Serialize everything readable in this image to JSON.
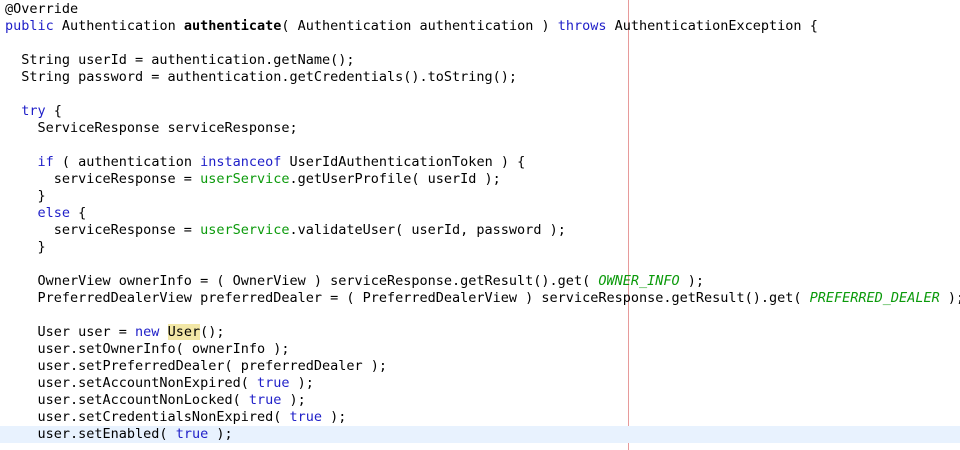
{
  "editor": {
    "lines": [
      [
        {
          "t": "@Override",
          "c": ""
        }
      ],
      [
        {
          "t": "public",
          "c": "kw2"
        },
        {
          "t": " Authentication ",
          "c": ""
        },
        {
          "t": "authenticate",
          "c": "bold"
        },
        {
          "t": "( Authentication authentication ) ",
          "c": ""
        },
        {
          "t": "throws",
          "c": "kw2"
        },
        {
          "t": " AuthenticationException {",
          "c": ""
        }
      ],
      [],
      [
        {
          "t": "  String userId = authentication.getName();",
          "c": ""
        }
      ],
      [
        {
          "t": "  String password = authentication.getCredentials().toString();",
          "c": ""
        }
      ],
      [],
      [
        {
          "t": "  ",
          "c": ""
        },
        {
          "t": "try",
          "c": "kw2"
        },
        {
          "t": " {",
          "c": ""
        }
      ],
      [
        {
          "t": "    ServiceResponse serviceResponse;",
          "c": ""
        }
      ],
      [],
      [
        {
          "t": "    ",
          "c": ""
        },
        {
          "t": "if",
          "c": "kw2"
        },
        {
          "t": " ( authentication ",
          "c": ""
        },
        {
          "t": "instanceof",
          "c": "kw2"
        },
        {
          "t": " UserIdAuthenticationToken ) {",
          "c": ""
        }
      ],
      [
        {
          "t": "      serviceResponse = ",
          "c": ""
        },
        {
          "t": "userService",
          "c": "field"
        },
        {
          "t": ".getUserProfile( userId );",
          "c": ""
        }
      ],
      [
        {
          "t": "    }",
          "c": ""
        }
      ],
      [
        {
          "t": "    ",
          "c": ""
        },
        {
          "t": "else",
          "c": "kw2"
        },
        {
          "t": " {",
          "c": ""
        }
      ],
      [
        {
          "t": "      serviceResponse = ",
          "c": ""
        },
        {
          "t": "userService",
          "c": "field"
        },
        {
          "t": ".validateUser( userId, password );",
          "c": ""
        }
      ],
      [
        {
          "t": "    }",
          "c": ""
        }
      ],
      [],
      [
        {
          "t": "    OwnerView ownerInfo = ( OwnerView ) serviceResponse.getResult().get( ",
          "c": ""
        },
        {
          "t": "OWNER_INFO",
          "c": "const"
        },
        {
          "t": " );",
          "c": ""
        }
      ],
      [
        {
          "t": "    PreferredDealerView preferredDealer = ( PreferredDealerView ) serviceResponse.getResult().get( ",
          "c": ""
        },
        {
          "t": "PREFERRED_DEALER",
          "c": "const"
        },
        {
          "t": " );",
          "c": ""
        }
      ],
      [],
      [
        {
          "t": "    User user = ",
          "c": ""
        },
        {
          "t": "new",
          "c": "kw2"
        },
        {
          "t": " ",
          "c": ""
        },
        {
          "t": "User",
          "c": "occ"
        },
        {
          "t": "();",
          "c": ""
        }
      ],
      [
        {
          "t": "    user.setOwnerInfo( ownerInfo );",
          "c": ""
        }
      ],
      [
        {
          "t": "    user.setPreferredDealer( preferredDealer );",
          "c": ""
        }
      ],
      [
        {
          "t": "    user.setAccountNonExpired( ",
          "c": ""
        },
        {
          "t": "true",
          "c": "kw2"
        },
        {
          "t": " );",
          "c": ""
        }
      ],
      [
        {
          "t": "    user.setAccountNonLocked( ",
          "c": ""
        },
        {
          "t": "true",
          "c": "kw2"
        },
        {
          "t": " );",
          "c": ""
        }
      ],
      [
        {
          "t": "    user.setCredentialsNonExpired( ",
          "c": ""
        },
        {
          "t": "true",
          "c": "kw2"
        },
        {
          "t": " );",
          "c": ""
        }
      ],
      [
        {
          "t": "    user.setEnabled( ",
          "c": ""
        },
        {
          "t": "true",
          "c": "kw2"
        },
        {
          "t": " );",
          "c": ""
        }
      ]
    ],
    "current_line_index": 25,
    "colors": {
      "keyword": "#1e1ec8",
      "field": "#0b9a0b",
      "constant": "#0b9a0b",
      "occurrence_highlight": "#f2e7a6",
      "current_line": "#e8f2fe",
      "print_margin": "#e79a9a"
    }
  }
}
